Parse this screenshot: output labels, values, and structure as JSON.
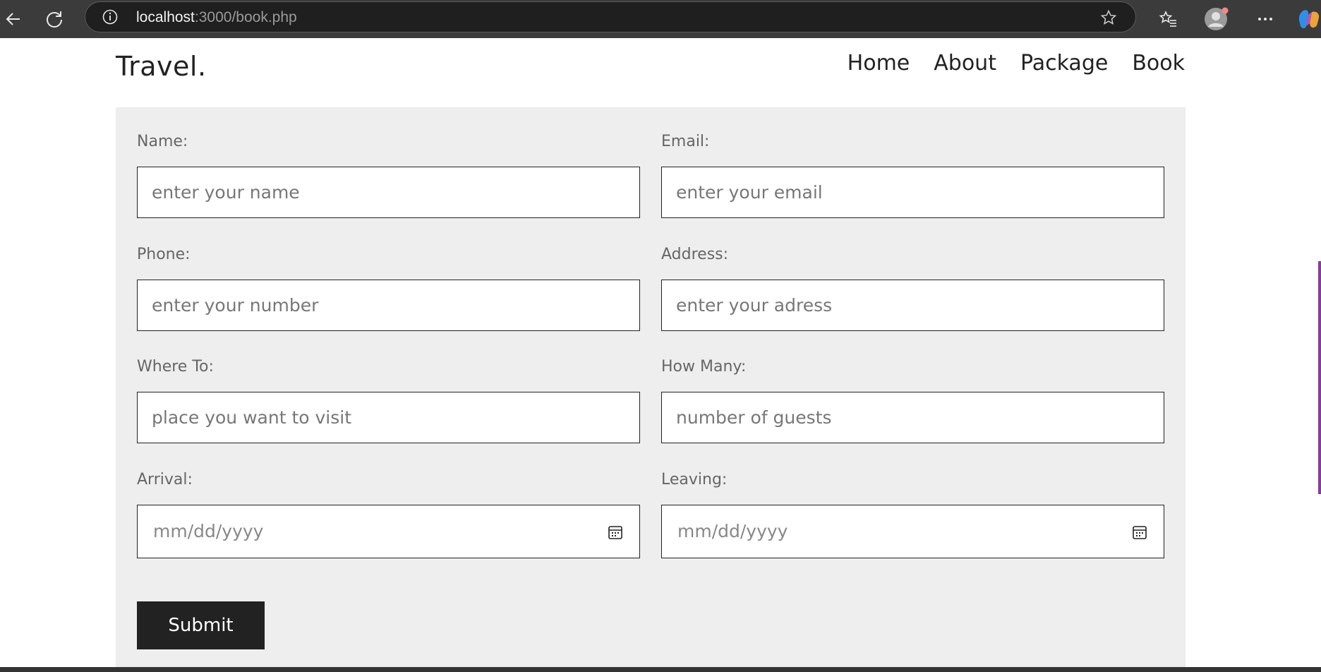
{
  "browser": {
    "url_host": "localhost",
    "url_path": ":3000/book.php"
  },
  "site": {
    "logo": "Travel.",
    "nav": [
      {
        "label": "Home"
      },
      {
        "label": "About"
      },
      {
        "label": "Package"
      },
      {
        "label": "Book"
      }
    ]
  },
  "form": {
    "fields": [
      {
        "label": "Name:",
        "placeholder": "enter your name"
      },
      {
        "label": "Email:",
        "placeholder": "enter your email"
      },
      {
        "label": "Phone:",
        "placeholder": "enter your number"
      },
      {
        "label": "Address:",
        "placeholder": "enter your adress"
      },
      {
        "label": "Where To:",
        "placeholder": "place you want to visit"
      },
      {
        "label": "How Many:",
        "placeholder": "number of guests"
      },
      {
        "label": "Arrival:",
        "value": "mm/dd/yyyy"
      },
      {
        "label": "Leaving:",
        "value": "mm/dd/yyyy"
      }
    ],
    "submit_label": "Submit"
  },
  "icons": {
    "back": "back-arrow-icon",
    "refresh": "refresh-icon",
    "info": "info-icon",
    "favorite": "star-icon",
    "favorites": "favorites-icon",
    "profile": "profile-avatar-icon",
    "more": "more-icon",
    "copilot": "copilot-icon",
    "calendar": "calendar-icon"
  }
}
